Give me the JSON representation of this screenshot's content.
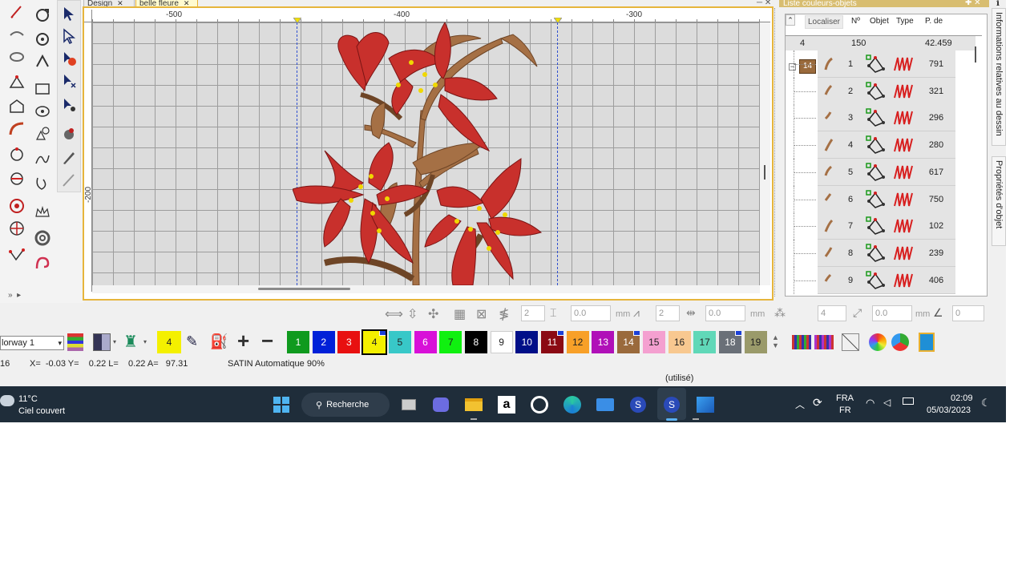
{
  "tabs": {
    "design": "Design",
    "belle": "belle fleure"
  },
  "ruler": {
    "top": [
      "-500",
      "-400",
      "-300"
    ],
    "left": [
      "-200"
    ]
  },
  "panel": {
    "title": "Liste couleurs-objets",
    "localiser": "Localiser",
    "columns": [
      "Nº",
      "Objet",
      "Type",
      "P. de"
    ],
    "summary": {
      "colors": "4",
      "objects": "150",
      "stitches": "42.459"
    },
    "group_color": "14",
    "rows": [
      {
        "no": "1",
        "stitches": "791"
      },
      {
        "no": "2",
        "stitches": "321"
      },
      {
        "no": "3",
        "stitches": "296"
      },
      {
        "no": "4",
        "stitches": "280"
      },
      {
        "no": "5",
        "stitches": "617"
      },
      {
        "no": "6",
        "stitches": "750"
      },
      {
        "no": "7",
        "stitches": "102"
      },
      {
        "no": "8",
        "stitches": "239"
      },
      {
        "no": "9",
        "stitches": "406"
      }
    ],
    "side_tab_info": "Informations relatives au dessin",
    "side_tab_props": "Propriétés d'objet"
  },
  "toolbar1": {
    "f1": "2",
    "f2": "0.0",
    "unit1": "mm",
    "f3": "2",
    "f4": "0.0",
    "unit2": "mm",
    "f5": "4",
    "f6": "0.0",
    "unit3": "mm",
    "f7": "0"
  },
  "toolbar2": {
    "colorway": "lorway 1",
    "current_color": "4",
    "swatches": [
      {
        "n": "1",
        "color": "#0f9a1e"
      },
      {
        "n": "2",
        "color": "#0020d8"
      },
      {
        "n": "3",
        "color": "#e81010"
      },
      {
        "n": "4",
        "color": "#f4f000"
      },
      {
        "n": "5",
        "color": "#38c8c8"
      },
      {
        "n": "6",
        "color": "#d810d8"
      },
      {
        "n": "7",
        "color": "#10f010"
      },
      {
        "n": "8",
        "color": "#000000"
      },
      {
        "n": "9",
        "color": "#ffffff"
      },
      {
        "n": "10",
        "color": "#000f88"
      },
      {
        "n": "11",
        "color": "#8b0a14"
      },
      {
        "n": "12",
        "color": "#f8a028"
      },
      {
        "n": "13",
        "color": "#b010b8"
      },
      {
        "n": "14",
        "color": "#9a6a3c"
      },
      {
        "n": "15",
        "color": "#f4a0d0"
      },
      {
        "n": "16",
        "color": "#f8c890"
      },
      {
        "n": "17",
        "color": "#60d8b8"
      },
      {
        "n": "18",
        "color": "#6a7078"
      },
      {
        "n": "19",
        "color": "#9a9a6a"
      }
    ]
  },
  "status": {
    "left": "16",
    "coords": "X=  -0.03 Y=    0.22 L=    0.22 A=   97.31",
    "mode": "SATIN Automatique 90%",
    "utilise": "(utilisé)"
  },
  "taskbar": {
    "temp": "11°C",
    "weather": "Ciel couvert",
    "search": "Recherche",
    "lang1": "FRA",
    "lang2": "FR",
    "time": "02:09",
    "date": "05/03/2023"
  }
}
